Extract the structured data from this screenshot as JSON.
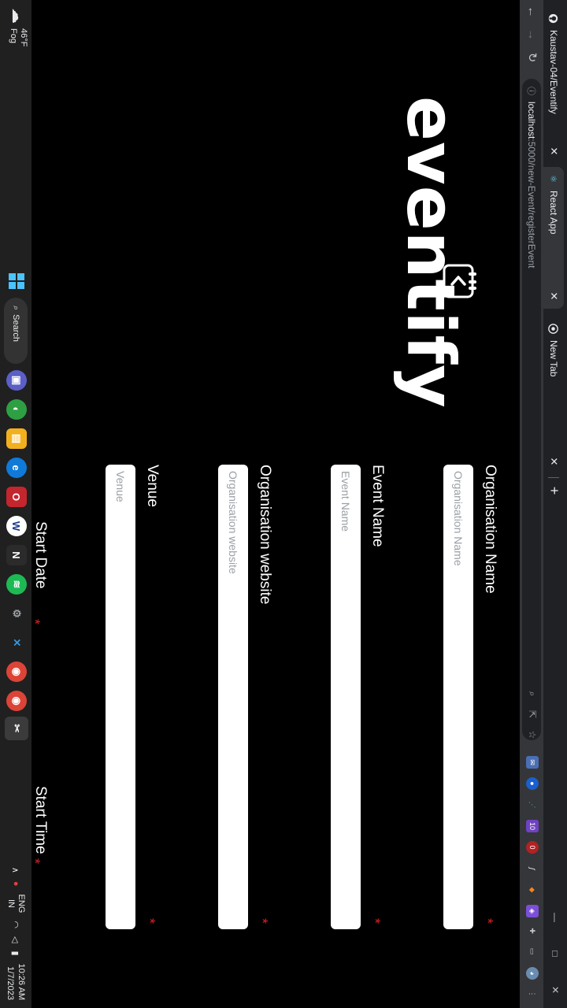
{
  "tabs": [
    {
      "label": "Kaustav-04/Eventify",
      "icon": "github-icon",
      "active": false
    },
    {
      "label": "React App",
      "icon": "react-icon",
      "active": true
    },
    {
      "label": "New Tab",
      "icon": "chrome-icon",
      "active": false
    }
  ],
  "address": {
    "host": "localhost",
    "path": ":5000/new-Event/registerEvent"
  },
  "logo": {
    "text": "eventify"
  },
  "form": {
    "fields": [
      {
        "label": "Organisation Name",
        "placeholder": "Organisation Name",
        "required": true
      },
      {
        "label": "Event Name",
        "placeholder": "Event Name",
        "required": true
      },
      {
        "label": "Organisation website",
        "placeholder": "Organisation website",
        "required": true
      },
      {
        "label": "Venue",
        "placeholder": "Venue",
        "required": true
      }
    ],
    "partial_labels": [
      "Start Date",
      "Start Time"
    ],
    "required_mark": "*"
  },
  "taskbar": {
    "weather": {
      "temp": "46°F",
      "condition": "Fog"
    },
    "search_label": "Search",
    "language": {
      "line1": "ENG",
      "line2": "IN"
    },
    "time": "10:26 AM",
    "date": "1/7/2023"
  },
  "colors": {
    "required": "#e02020",
    "background": "#000000",
    "tab_active": "#35363a"
  }
}
